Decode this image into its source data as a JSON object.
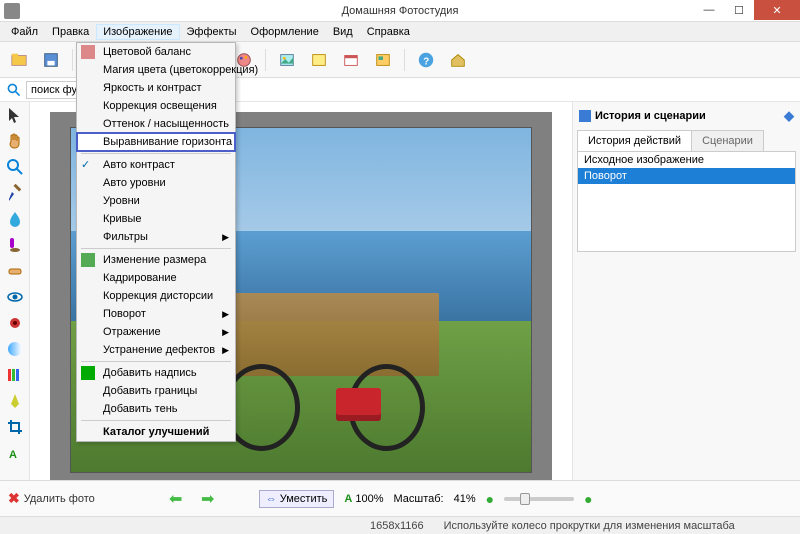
{
  "title": "Домашняя Фотостудия",
  "menu": [
    "Файл",
    "Правка",
    "Изображение",
    "Эффекты",
    "Оформление",
    "Вид",
    "Справка"
  ],
  "menu_open_idx": 2,
  "search_placeholder": "поиск фу",
  "dropdown": [
    {
      "label": "Цветовой баланс",
      "icon": "#d88"
    },
    {
      "label": "Магия цвета (цветокоррекция)"
    },
    {
      "label": "Яркость и контраст"
    },
    {
      "label": "Коррекция освещения"
    },
    {
      "label": "Оттенок / насыщенность"
    },
    {
      "label": "Выравнивание горизонта",
      "hl": true
    },
    {
      "sep": true
    },
    {
      "label": "Авто контраст",
      "check": true
    },
    {
      "label": "Авто уровни"
    },
    {
      "label": "Уровни"
    },
    {
      "label": "Кривые"
    },
    {
      "label": "Фильтры",
      "sub": true
    },
    {
      "sep": true
    },
    {
      "label": "Изменение размера",
      "icon": "#5a5"
    },
    {
      "label": "Кадрирование"
    },
    {
      "label": "Коррекция дисторсии"
    },
    {
      "label": "Поворот",
      "sub": true
    },
    {
      "label": "Отражение",
      "sub": true
    },
    {
      "label": "Устранение дефектов",
      "sub": true
    },
    {
      "sep": true
    },
    {
      "label": "Добавить надпись",
      "icon": "#0a0"
    },
    {
      "label": "Добавить границы"
    },
    {
      "label": "Добавить тень"
    },
    {
      "sep": true
    },
    {
      "label": "Каталог улучшений",
      "bold": true
    }
  ],
  "panel": {
    "title": "История и сценарии",
    "tabs": [
      "История действий",
      "Сценарии"
    ],
    "history": [
      "Исходное изображение",
      "Поворот"
    ],
    "sel": 1
  },
  "bottom": {
    "delete": "Удалить фото",
    "fit": "Уместить",
    "zoom100": "100%",
    "scale_label": "Масштаб:",
    "scale_val": "41%",
    "dims": "1658x1166",
    "hint": "Используйте колесо прокрутки для изменения масштаба"
  }
}
